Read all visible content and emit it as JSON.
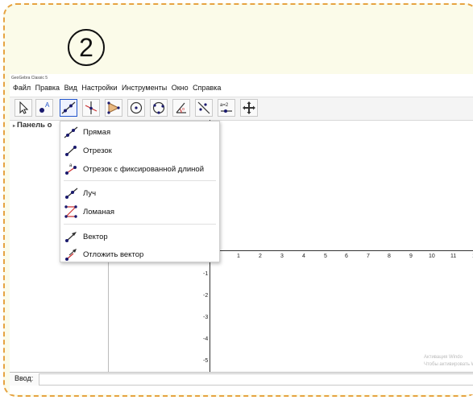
{
  "step_number": "2",
  "app": {
    "window_title": "GeoGebra Classic 5",
    "menu": [
      "Файл",
      "Правка",
      "Вид",
      "Настройки",
      "Инструменты",
      "Окно",
      "Справка"
    ],
    "toolbar": {
      "tools": [
        "move-tool",
        "point-tool",
        "line-tool",
        "perpendicular-tool",
        "polygon-tool",
        "circle-tool",
        "conic-tool",
        "angle-tool",
        "reflect-tool",
        "slider-tool",
        "move-view-tool"
      ],
      "slider_label": "a=2",
      "active_tool": "line-tool"
    },
    "algebra_header": "Панель о",
    "dropdown": {
      "groups": [
        [
          "Прямая",
          "Отрезок",
          "Отрезок с фиксированной длиной"
        ],
        [
          "Луч",
          "Ломаная"
        ],
        [
          "Вектор",
          "Отложить вектор"
        ]
      ]
    },
    "graphics": {
      "x_ticks": [
        "1",
        "2",
        "3",
        "4",
        "5",
        "6",
        "7",
        "8",
        "9",
        "10",
        "11",
        "1"
      ],
      "y_ticks": [
        "-1",
        "-2",
        "-3",
        "-4",
        "-5"
      ]
    },
    "input_label": "Ввод:",
    "watermark": [
      "Активация Windo",
      "Чтобы активировать W"
    ]
  },
  "colors": {
    "card_background": "#fbfbe9",
    "card_border": "#e6a341",
    "active_tool_border": "#2255cc"
  }
}
